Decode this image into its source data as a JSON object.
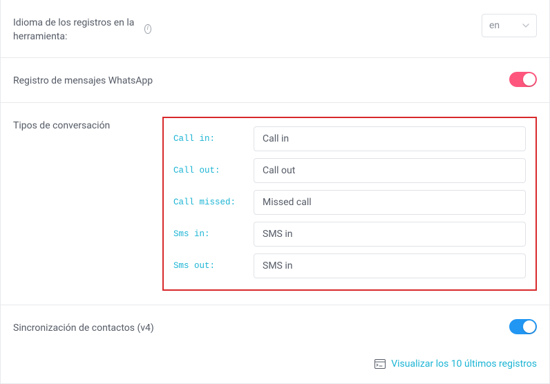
{
  "language_row": {
    "label": "Idioma de los registros en la herramienta:",
    "selected": "en"
  },
  "whatsapp_row": {
    "label": "Registro de mensajes WhatsApp"
  },
  "conversation": {
    "title": "Tipos de conversación",
    "items": [
      {
        "label": "Call in:",
        "value": "Call in"
      },
      {
        "label": "Call out:",
        "value": "Call out"
      },
      {
        "label": "Call missed:",
        "value": "Missed call"
      },
      {
        "label": "Sms in:",
        "value": "SMS in"
      },
      {
        "label": "Sms out:",
        "value": "SMS in"
      }
    ]
  },
  "sync_row": {
    "label": "Sincronización de contactos (v4)",
    "link": "Visualizar los 10 últimos registros"
  },
  "colors": {
    "highlight_border": "#d8292b",
    "accent_teal": "#1bb4d4",
    "toggle_pink": "#ff567d",
    "toggle_blue": "#2196f3"
  }
}
